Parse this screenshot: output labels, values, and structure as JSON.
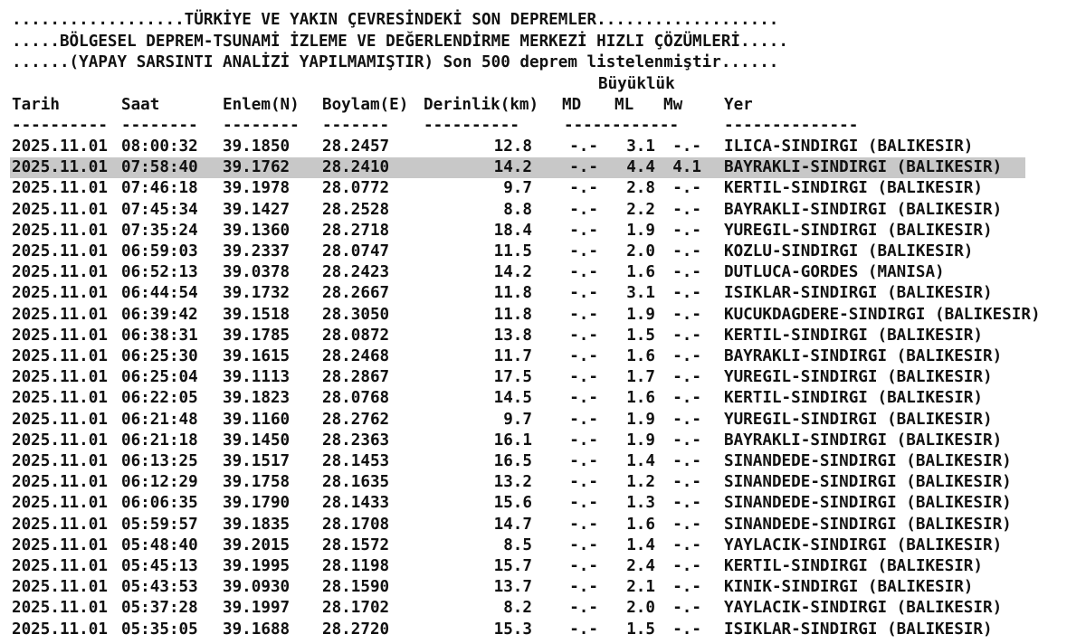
{
  "banner": {
    "line1": "..................TÜRKİYE VE YAKIN ÇEVRESİNDEKİ SON DEPREMLER...................",
    "line2": ".....BÖLGESEL DEPREM-TSUNAMİ İZLEME VE DEĞERLENDİRME MERKEZİ HIZLI ÇÖZÜMLERİ.....",
    "line3": "......(YAPAY SARSINTI ANALİZİ YAPILMAMIŞTIR) Son 500 deprem listelenmiştir......"
  },
  "header": {
    "group": "Büyüklük",
    "tarih": "Tarih",
    "saat": "Saat",
    "enlem": "Enlem(N)",
    "boylam": "Boylam(E)",
    "derinlik": "Derinlik(km)",
    "md": "MD",
    "ml": "ML",
    "mw": "Mw",
    "yer": "Yer",
    "sep_tarih": "----------",
    "sep_saat": "--------",
    "sep_enlem": "--------",
    "sep_boylam": "-------",
    "sep_der": "----------",
    "sep_mag": "------------",
    "sep_yer": "--------------"
  },
  "rows": [
    {
      "tarih": "2025.11.01",
      "saat": "08:00:32",
      "enlem": "39.1850",
      "boylam": "28.2457",
      "der": "12.8",
      "md": "-.-",
      "ml": "3.1",
      "mw": "-.-",
      "yer": "ILICA-SINDIRGI (BALIKESIR)",
      "hl": false
    },
    {
      "tarih": "2025.11.01",
      "saat": "07:58:40",
      "enlem": "39.1762",
      "boylam": "28.2410",
      "der": "14.2",
      "md": "-.-",
      "ml": "4.4",
      "mw": "4.1",
      "yer": "BAYRAKLI-SINDIRGI (BALIKESIR)",
      "hl": true
    },
    {
      "tarih": "2025.11.01",
      "saat": "07:46:18",
      "enlem": "39.1978",
      "boylam": "28.0772",
      "der": "9.7",
      "md": "-.-",
      "ml": "2.8",
      "mw": "-.-",
      "yer": "KERTIL-SINDIRGI (BALIKESIR)",
      "hl": false
    },
    {
      "tarih": "2025.11.01",
      "saat": "07:45:34",
      "enlem": "39.1427",
      "boylam": "28.2528",
      "der": "8.8",
      "md": "-.-",
      "ml": "2.2",
      "mw": "-.-",
      "yer": "BAYRAKLI-SINDIRGI (BALIKESIR)",
      "hl": false
    },
    {
      "tarih": "2025.11.01",
      "saat": "07:35:24",
      "enlem": "39.1360",
      "boylam": "28.2718",
      "der": "18.4",
      "md": "-.-",
      "ml": "1.9",
      "mw": "-.-",
      "yer": "YUREGIL-SINDIRGI (BALIKESIR)",
      "hl": false
    },
    {
      "tarih": "2025.11.01",
      "saat": "06:59:03",
      "enlem": "39.2337",
      "boylam": "28.0747",
      "der": "11.5",
      "md": "-.-",
      "ml": "2.0",
      "mw": "-.-",
      "yer": "KOZLU-SINDIRGI (BALIKESIR)",
      "hl": false
    },
    {
      "tarih": "2025.11.01",
      "saat": "06:52:13",
      "enlem": "39.0378",
      "boylam": "28.2423",
      "der": "14.2",
      "md": "-.-",
      "ml": "1.6",
      "mw": "-.-",
      "yer": "DUTLUCA-GORDES (MANISA)",
      "hl": false
    },
    {
      "tarih": "2025.11.01",
      "saat": "06:44:54",
      "enlem": "39.1732",
      "boylam": "28.2667",
      "der": "11.8",
      "md": "-.-",
      "ml": "3.1",
      "mw": "-.-",
      "yer": "ISIKLAR-SINDIRGI (BALIKESIR)",
      "hl": false
    },
    {
      "tarih": "2025.11.01",
      "saat": "06:39:42",
      "enlem": "39.1518",
      "boylam": "28.3050",
      "der": "11.8",
      "md": "-.-",
      "ml": "1.9",
      "mw": "-.-",
      "yer": "KUCUKDAGDERE-SINDIRGI (BALIKESIR)",
      "hl": false
    },
    {
      "tarih": "2025.11.01",
      "saat": "06:38:31",
      "enlem": "39.1785",
      "boylam": "28.0872",
      "der": "13.8",
      "md": "-.-",
      "ml": "1.5",
      "mw": "-.-",
      "yer": "KERTIL-SINDIRGI (BALIKESIR)",
      "hl": false
    },
    {
      "tarih": "2025.11.01",
      "saat": "06:25:30",
      "enlem": "39.1615",
      "boylam": "28.2468",
      "der": "11.7",
      "md": "-.-",
      "ml": "1.6",
      "mw": "-.-",
      "yer": "BAYRAKLI-SINDIRGI (BALIKESIR)",
      "hl": false
    },
    {
      "tarih": "2025.11.01",
      "saat": "06:25:04",
      "enlem": "39.1113",
      "boylam": "28.2867",
      "der": "17.5",
      "md": "-.-",
      "ml": "1.7",
      "mw": "-.-",
      "yer": "YUREGIL-SINDIRGI (BALIKESIR)",
      "hl": false
    },
    {
      "tarih": "2025.11.01",
      "saat": "06:22:05",
      "enlem": "39.1823",
      "boylam": "28.0768",
      "der": "14.5",
      "md": "-.-",
      "ml": "1.6",
      "mw": "-.-",
      "yer": "KERTIL-SINDIRGI (BALIKESIR)",
      "hl": false
    },
    {
      "tarih": "2025.11.01",
      "saat": "06:21:48",
      "enlem": "39.1160",
      "boylam": "28.2762",
      "der": "9.7",
      "md": "-.-",
      "ml": "1.9",
      "mw": "-.-",
      "yer": "YUREGIL-SINDIRGI (BALIKESIR)",
      "hl": false
    },
    {
      "tarih": "2025.11.01",
      "saat": "06:21:18",
      "enlem": "39.1450",
      "boylam": "28.2363",
      "der": "16.1",
      "md": "-.-",
      "ml": "1.9",
      "mw": "-.-",
      "yer": "BAYRAKLI-SINDIRGI (BALIKESIR)",
      "hl": false
    },
    {
      "tarih": "2025.11.01",
      "saat": "06:13:25",
      "enlem": "39.1517",
      "boylam": "28.1453",
      "der": "16.5",
      "md": "-.-",
      "ml": "1.4",
      "mw": "-.-",
      "yer": "SINANDEDE-SINDIRGI (BALIKESIR)",
      "hl": false
    },
    {
      "tarih": "2025.11.01",
      "saat": "06:12:29",
      "enlem": "39.1758",
      "boylam": "28.1635",
      "der": "13.2",
      "md": "-.-",
      "ml": "1.2",
      "mw": "-.-",
      "yer": "SINANDEDE-SINDIRGI (BALIKESIR)",
      "hl": false
    },
    {
      "tarih": "2025.11.01",
      "saat": "06:06:35",
      "enlem": "39.1790",
      "boylam": "28.1433",
      "der": "15.6",
      "md": "-.-",
      "ml": "1.3",
      "mw": "-.-",
      "yer": "SINANDEDE-SINDIRGI (BALIKESIR)",
      "hl": false
    },
    {
      "tarih": "2025.11.01",
      "saat": "05:59:57",
      "enlem": "39.1835",
      "boylam": "28.1708",
      "der": "14.7",
      "md": "-.-",
      "ml": "1.6",
      "mw": "-.-",
      "yer": "SINANDEDE-SINDIRGI (BALIKESIR)",
      "hl": false
    },
    {
      "tarih": "2025.11.01",
      "saat": "05:48:40",
      "enlem": "39.2015",
      "boylam": "28.1572",
      "der": "8.5",
      "md": "-.-",
      "ml": "1.4",
      "mw": "-.-",
      "yer": "YAYLACIK-SINDIRGI (BALIKESIR)",
      "hl": false
    },
    {
      "tarih": "2025.11.01",
      "saat": "05:45:13",
      "enlem": "39.1995",
      "boylam": "28.1198",
      "der": "15.7",
      "md": "-.-",
      "ml": "2.4",
      "mw": "-.-",
      "yer": "KERTIL-SINDIRGI (BALIKESIR)",
      "hl": false
    },
    {
      "tarih": "2025.11.01",
      "saat": "05:43:53",
      "enlem": "39.0930",
      "boylam": "28.1590",
      "der": "13.7",
      "md": "-.-",
      "ml": "2.1",
      "mw": "-.-",
      "yer": "KINIK-SINDIRGI (BALIKESIR)",
      "hl": false
    },
    {
      "tarih": "2025.11.01",
      "saat": "05:37:28",
      "enlem": "39.1997",
      "boylam": "28.1702",
      "der": "8.2",
      "md": "-.-",
      "ml": "2.0",
      "mw": "-.-",
      "yer": "YAYLACIK-SINDIRGI (BALIKESIR)",
      "hl": false
    },
    {
      "tarih": "2025.11.01",
      "saat": "05:35:05",
      "enlem": "39.1688",
      "boylam": "28.2720",
      "der": "15.3",
      "md": "-.-",
      "ml": "1.5",
      "mw": "-.-",
      "yer": "ISIKLAR-SINDIRGI (BALIKESIR)",
      "hl": false
    }
  ]
}
